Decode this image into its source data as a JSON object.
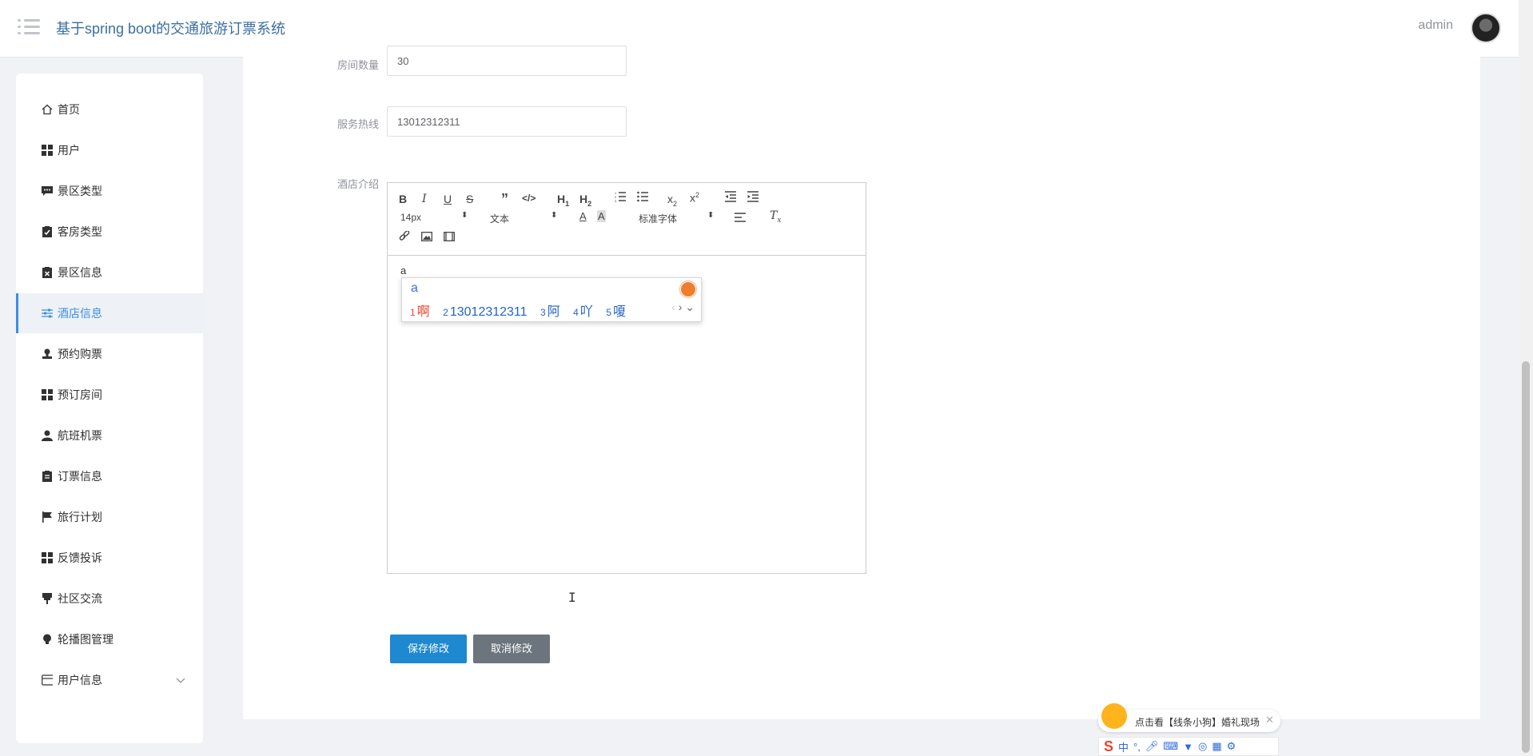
{
  "header": {
    "title": "基于spring boot的交通旅游订票系统",
    "user": "admin"
  },
  "sidebar": {
    "items": [
      {
        "label": "首页",
        "icon": "home-icon"
      },
      {
        "label": "用户",
        "icon": "grid-icon"
      },
      {
        "label": "景区类型",
        "icon": "comment-icon"
      },
      {
        "label": "客房类型",
        "icon": "clipboard-check-icon"
      },
      {
        "label": "景区信息",
        "icon": "clipboard-x-icon"
      },
      {
        "label": "酒店信息",
        "icon": "sliders-icon",
        "active": true
      },
      {
        "label": "预约购票",
        "icon": "stamp-icon"
      },
      {
        "label": "预订房间",
        "icon": "grid-icon"
      },
      {
        "label": "航班机票",
        "icon": "user-icon"
      },
      {
        "label": "订票信息",
        "icon": "clipboard-icon"
      },
      {
        "label": "旅行计划",
        "icon": "flag-icon"
      },
      {
        "label": "反馈投诉",
        "icon": "grid-icon"
      },
      {
        "label": "社区交流",
        "icon": "marker-icon"
      },
      {
        "label": "轮播图管理",
        "icon": "bulb-icon"
      },
      {
        "label": "用户信息",
        "icon": "card-icon",
        "expandable": true
      }
    ]
  },
  "form": {
    "room_count_label": "房间数量",
    "room_count_value": "30",
    "hotline_label": "服务热线",
    "hotline_value": "13012312311",
    "intro_label": "酒店介绍",
    "editor": {
      "font_size": "14px",
      "block_type": "文本",
      "font_family": "标准字体",
      "content": "a"
    },
    "save_label": "保存修改",
    "cancel_label": "取消修改"
  },
  "ime_popup": {
    "input": "a",
    "candidates": [
      {
        "n": "1",
        "text": "啊"
      },
      {
        "n": "2",
        "text": "13012312311"
      },
      {
        "n": "3",
        "text": "阿"
      },
      {
        "n": "4",
        "text": "吖"
      },
      {
        "n": "5",
        "text": "嗄"
      }
    ]
  },
  "ime_toast": {
    "text": "点击看【线条小狗】婚礼现场"
  },
  "ime_bar": {
    "mode": "中"
  },
  "colors": {
    "accent": "#3a8ee6",
    "save_button": "#1e88d0",
    "cancel_button": "#6c757d"
  }
}
